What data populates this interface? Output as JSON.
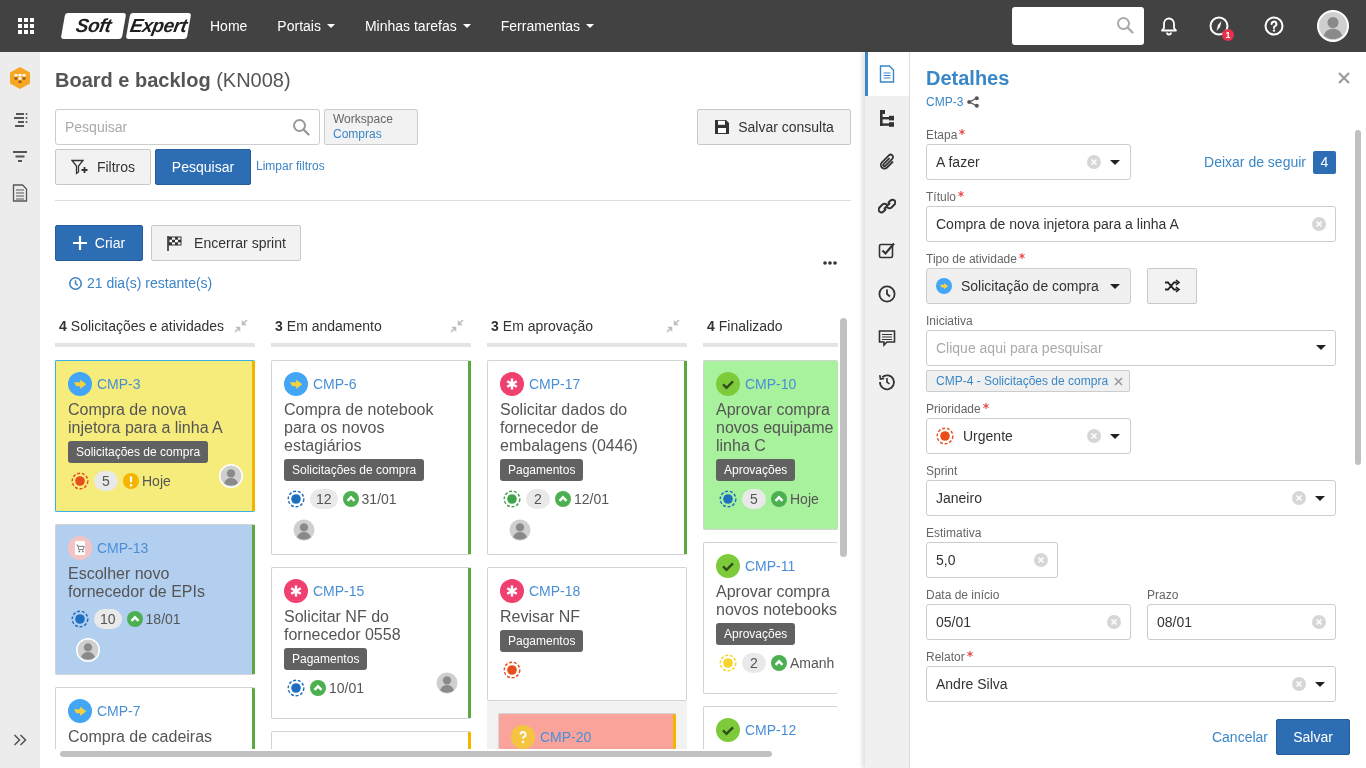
{
  "topbar": {
    "logo": [
      "Soft",
      "Expert"
    ],
    "nav": [
      {
        "label": "Home",
        "dropdown": false
      },
      {
        "label": "Portais",
        "dropdown": true
      },
      {
        "label": "Minhas tarefas",
        "dropdown": true
      },
      {
        "label": "Ferramentas",
        "dropdown": true
      }
    ],
    "alerts_badge": "1"
  },
  "page": {
    "title": "**Board e backlog** (KN008)",
    "search": {
      "placeholder": "Pesquisar"
    },
    "workspace": {
      "label": "Workspace",
      "value": "Compras"
    },
    "save_query": "Salvar consulta",
    "filters": "Filtros",
    "search_button": "Pesquisar",
    "clear_filters": "Limpar filtros",
    "create": "Criar",
    "end_sprint": "Encerrar sprint",
    "remaining": "21 dia(s) restante(s)"
  },
  "board": {
    "columns": [
      {
        "count": "4",
        "name": "Solicitações e atividades",
        "collapsible": true,
        "cards": [
          {
            "kind": "request",
            "id": "CMP-3",
            "title": "Compra de nova injetora para a linha A",
            "tag": "Solicitações de compra",
            "priority": {
              "color": "#e84e1b"
            },
            "count": "5",
            "due": {
              "kind": "late",
              "text": "Hoje"
            },
            "assignee": {
              "own_line": false
            },
            "color": "#f6ec7b",
            "bar": {
              "color": "#f4b400"
            },
            "selected": true
          },
          {
            "kind": "supplier",
            "id": "CMP-13",
            "title": "Escolher novo fornecedor de EPIs",
            "priority": {
              "color": "#1f6fbf"
            },
            "count": "10",
            "due": {
              "kind": "on_time",
              "text": "18/01"
            },
            "assignee": {
              "own_line": true
            },
            "color": "#b2cff0",
            "bar": {
              "color": "#5ba940"
            },
            "selected": false
          },
          {
            "kind": "request",
            "id": "CMP-7",
            "title": "Compra de cadeiras",
            "color": "#ffffff",
            "bar": {
              "color": "#5ba940"
            },
            "selected": false
          }
        ]
      },
      {
        "count": "3",
        "name": "Em andamento",
        "collapsible": true,
        "cards": [
          {
            "kind": "request",
            "id": "CMP-6",
            "title": "Compra de notebook para os novos estagiários",
            "tag": "Solicitações de compra",
            "priority": {
              "color": "#1f6fbf"
            },
            "count": "12",
            "due": {
              "kind": "on_time",
              "text": "31/01"
            },
            "assignee": {
              "own_line": true
            },
            "color": "#ffffff",
            "bar": {
              "color": "#5ba940"
            },
            "selected": false
          },
          {
            "kind": "task",
            "id": "CMP-15",
            "title": "Solicitar NF do fornecedor 0558",
            "tag": "Pagamentos",
            "priority": {
              "color": "#1f6fbf"
            },
            "due": {
              "kind": "on_time",
              "text": "10/01"
            },
            "assignee": {
              "own_line": false
            },
            "color": "#ffffff",
            "bar": {
              "color": "#5ba940"
            },
            "selected": false
          },
          {
            "color": "#ffffff",
            "bar": {
              "color": "#f4b400"
            },
            "selected": false
          }
        ]
      },
      {
        "count": "3",
        "name": "Em aprovação",
        "collapsible": true,
        "cards": [
          {
            "kind": "task",
            "id": "CMP-17",
            "title": "Solicitar dados do fornecedor de embalagens (0446)",
            "tag": "Pagamentos",
            "priority": {
              "color": "#3fa34d"
            },
            "count": "2",
            "due": {
              "kind": "on_time",
              "text": "12/01"
            },
            "assignee": {
              "own_line": true
            },
            "color": "#ffffff",
            "bar": {
              "color": "#5ba940"
            },
            "selected": false
          },
          {
            "kind": "task",
            "id": "CMP-18",
            "title": "Revisar NF",
            "tag": "Pagamentos",
            "priority": {
              "color": "#e84e1b"
            },
            "color": "#ffffff",
            "selected": false
          }
        ],
        "group": [
          {
            "kind": "question",
            "id": "CMP-20",
            "color": "#f9a39b",
            "bar": {
              "color": "#f4b400"
            },
            "selected": false
          }
        ]
      },
      {
        "count": "4",
        "name": "Finalizado",
        "collapsible": false,
        "cards": [
          {
            "kind": "approval",
            "id": "CMP-10",
            "title": "Aprovar compra\nnovos equipame\nlinha C",
            "tag": "Aprovações",
            "priority": {
              "color": "#1f6fbf"
            },
            "count": "5",
            "due": {
              "kind": "on_time",
              "text": "Hoje"
            },
            "color": "#a9f29d",
            "selected": false
          },
          {
            "kind": "approval",
            "id": "CMP-11",
            "title": "Aprovar compra\nnovos notebooks",
            "tag": "Aprovações",
            "priority": {
              "color": "#f5d327"
            },
            "count": "2",
            "due": {
              "kind": "on_time",
              "text": "Amanh"
            },
            "color": "#ffffff",
            "selected": false
          },
          {
            "kind": "approval",
            "id": "CMP-12",
            "color": "#ffffff",
            "selected": false
          }
        ]
      }
    ]
  },
  "details": {
    "tabs": [
      {
        "selected": true
      },
      {
        "selected": false
      },
      {
        "selected": false
      },
      {
        "selected": false
      },
      {
        "selected": false
      },
      {
        "selected": false
      },
      {
        "selected": false
      },
      {
        "selected": false
      }
    ],
    "title": "Detalhes",
    "id": "CMP-3",
    "follow": {
      "label": "Deixar de seguir",
      "count": "4"
    },
    "stage": {
      "label": "Etapa",
      "required": true,
      "value": "A fazer"
    },
    "title_field": {
      "label": "Título",
      "required": true,
      "value": "Compra de nova injetora para a linha A"
    },
    "activity_type": {
      "label": "Tipo de atividade",
      "required": true,
      "kind": "request",
      "value": "Solicitação de compra"
    },
    "initiative": {
      "label": "Iniciativa",
      "required": false,
      "placeholder": "Clique aqui para pesquisar",
      "chips": [
        "CMP-4 - Solicitações de compra"
      ]
    },
    "priority": {
      "label": "Prioridade",
      "required": true,
      "value": "Urgente",
      "color": "#e84e1b"
    },
    "sprint": {
      "label": "Sprint",
      "required": false,
      "value": "Janeiro"
    },
    "estimate": {
      "label": "Estimativa",
      "required": false,
      "value": "5,0"
    },
    "start_date": {
      "label": "Data de início",
      "required": false,
      "value": "05/01"
    },
    "due_date": {
      "label": "Prazo",
      "required": false,
      "value": "08/01"
    },
    "reporter": {
      "label": "Relator",
      "required": true,
      "value": "Andre Silva"
    },
    "cancel": "Cancelar",
    "save": "Salvar"
  }
}
